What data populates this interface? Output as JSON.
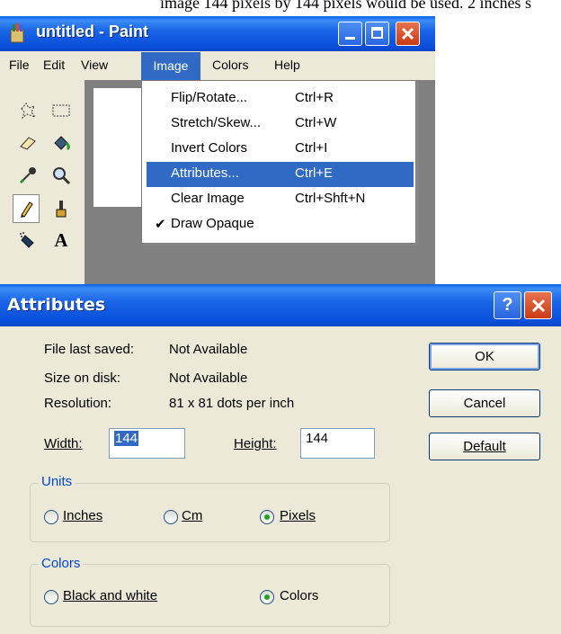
{
  "top_caption": "image 144 pixels by 144 pixels would be used. 2 inches s",
  "paint": {
    "title": "untitled - Paint",
    "menus": [
      "File",
      "Edit",
      "View",
      "Image",
      "Colors",
      "Help"
    ],
    "active_menu": "Image",
    "tools": [
      "free-select-icon",
      "rect-select-icon",
      "eraser-icon",
      "fill-icon",
      "color-picker-icon",
      "magnifier-icon",
      "pencil-icon",
      "brush-icon",
      "airbrush-icon",
      "text-icon"
    ]
  },
  "image_menu": {
    "items": [
      {
        "label": "Flip/Rotate...",
        "shortcut": "Ctrl+R"
      },
      {
        "label": "Stretch/Skew...",
        "shortcut": "Ctrl+W"
      },
      {
        "label": "Invert Colors",
        "shortcut": "Ctrl+I"
      },
      {
        "label": "Attributes...",
        "shortcut": "Ctrl+E",
        "highlighted": true
      },
      {
        "label": "Clear Image",
        "shortcut": "Ctrl+Shft+N"
      },
      {
        "label": "Draw Opaque",
        "shortcut": "",
        "checked": true
      }
    ]
  },
  "attributes": {
    "title": "Attributes",
    "file_last_saved_label": "File last saved:",
    "file_last_saved_value": "Not Available",
    "size_on_disk_label": "Size on disk:",
    "size_on_disk_value": "Not Available",
    "resolution_label": "Resolution:",
    "resolution_value": "81 x 81 dots per inch",
    "width_label": "Width:",
    "width_value": "144",
    "height_label": "Height:",
    "height_value": "144",
    "units_title": "Units",
    "units": [
      {
        "label": "Inches",
        "selected": false
      },
      {
        "label": "Cm",
        "selected": false
      },
      {
        "label": "Pixels",
        "selected": true
      }
    ],
    "colors_title": "Colors",
    "colors": [
      {
        "label": "Black and white",
        "selected": false
      },
      {
        "label": "Colors",
        "selected": true
      }
    ],
    "buttons": {
      "ok": "OK",
      "cancel": "Cancel",
      "default": "Default"
    },
    "help_glyph": "?",
    "close_glyph": "X"
  },
  "colors": {
    "titlebar": "#0a4fdb",
    "menu_highlight": "#316ac5",
    "window_bg": "#ece9d8",
    "group_title": "#0046d5"
  }
}
